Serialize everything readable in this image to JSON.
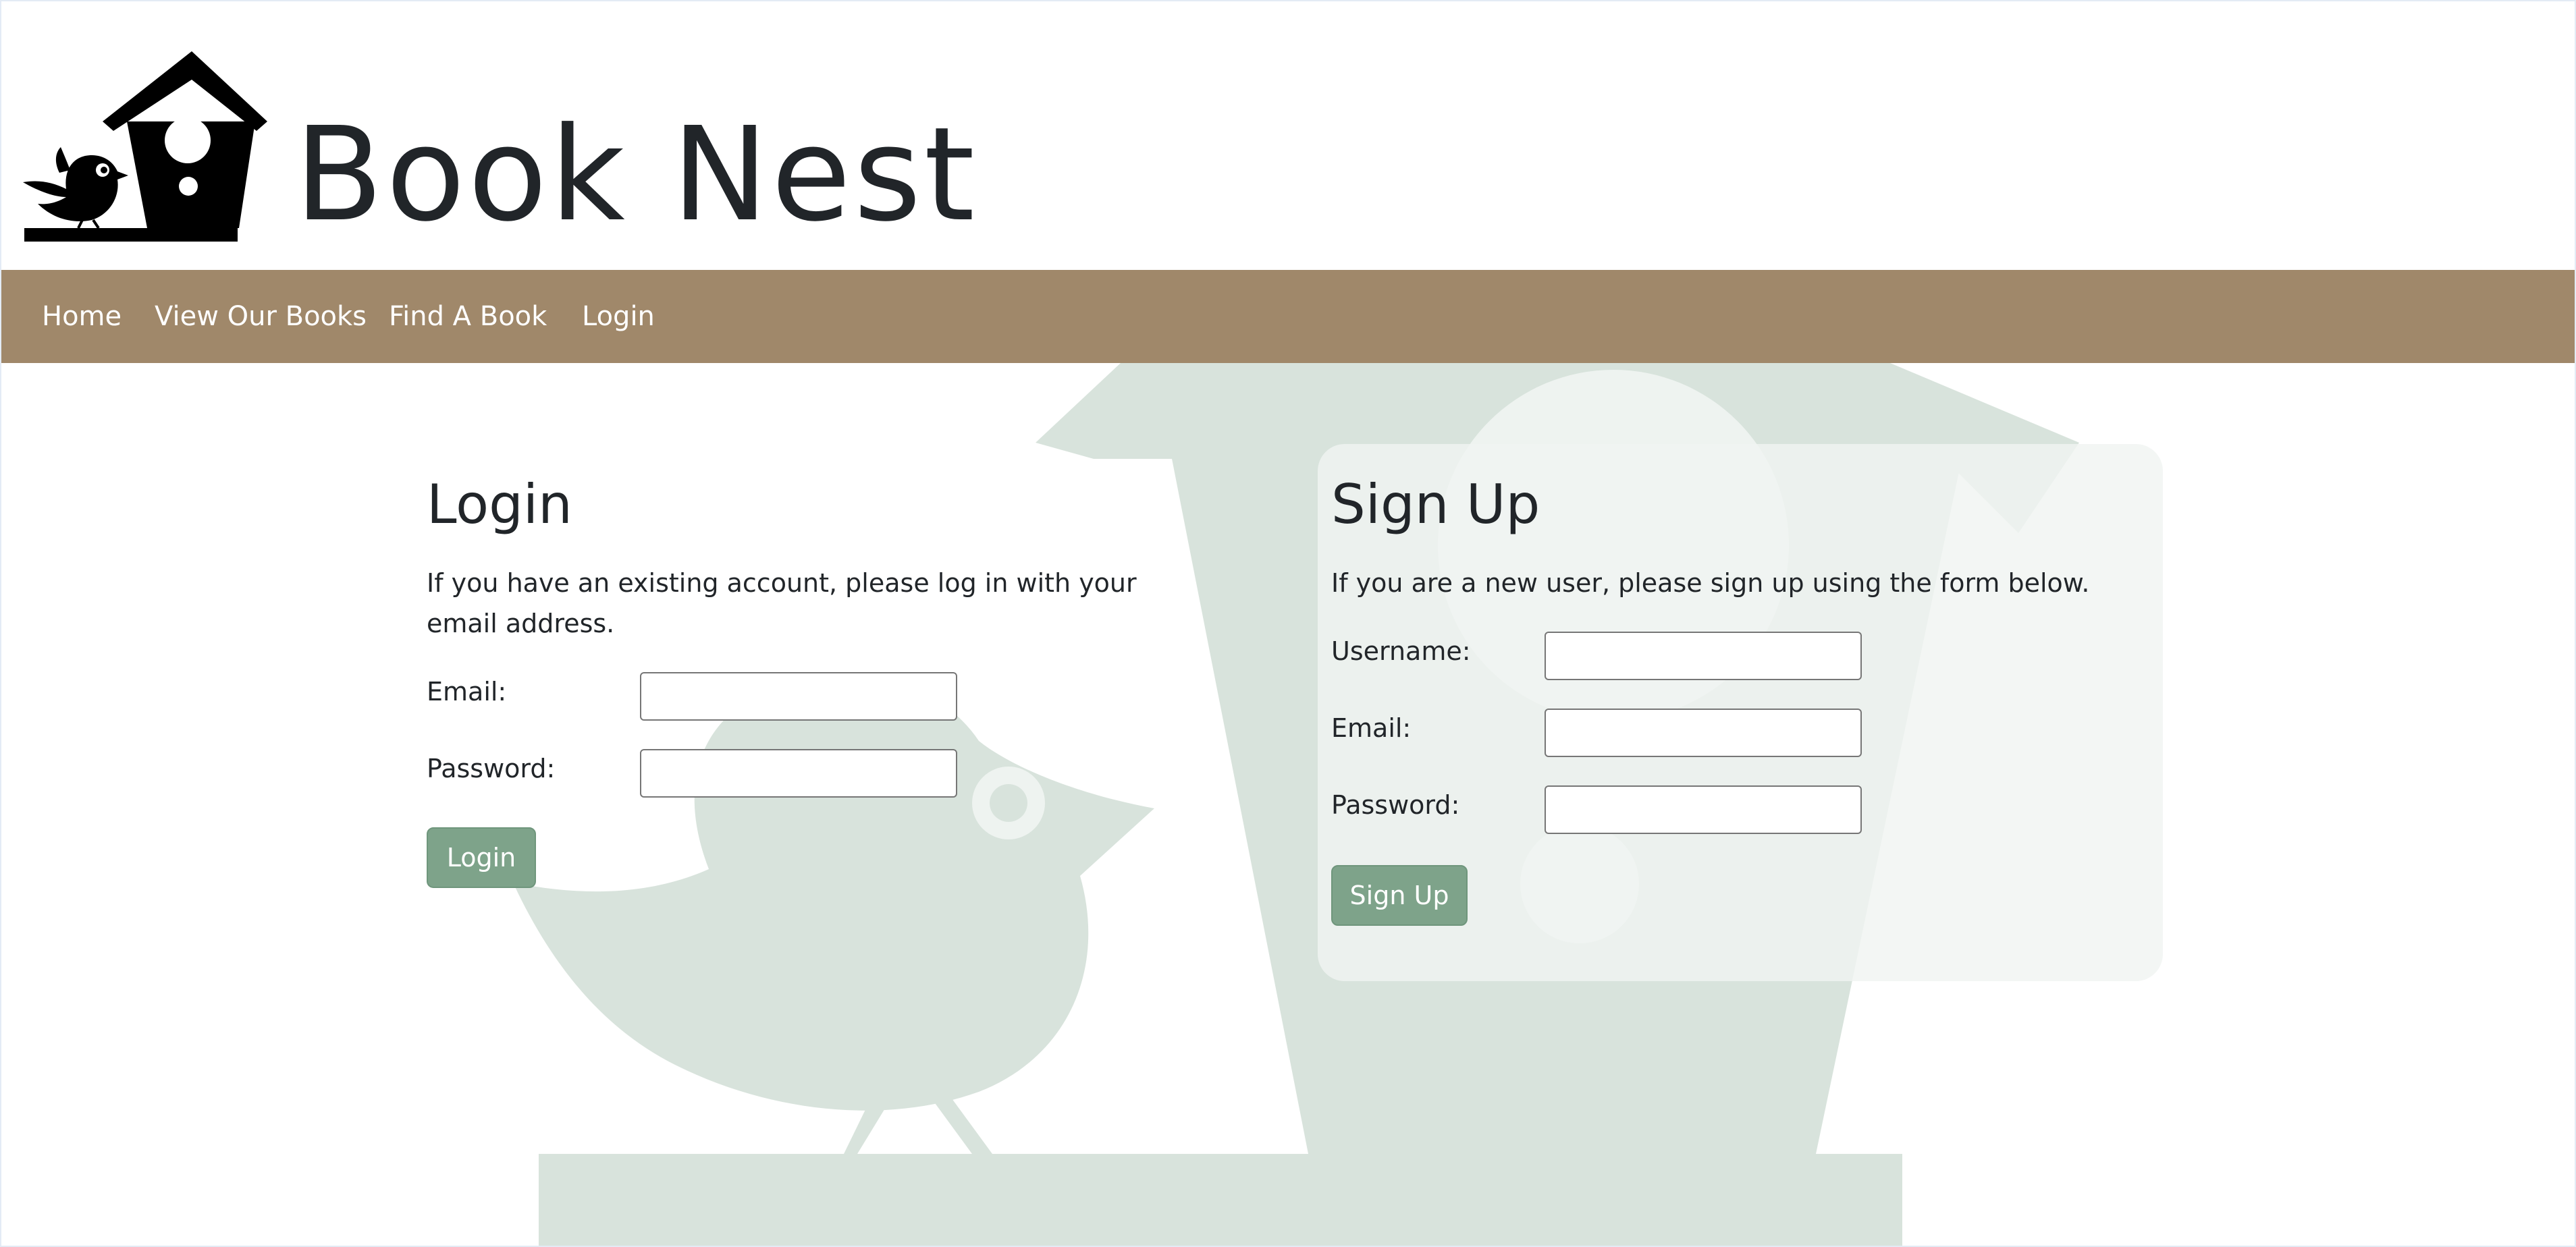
{
  "site": {
    "title": "Book Nest"
  },
  "nav": {
    "items": [
      "Home",
      "View Our Books",
      "Find A Book",
      "Login"
    ]
  },
  "login": {
    "title": "Login",
    "description": "If you have an existing account, please log in with your email address.",
    "email_label": "Email:",
    "email_value": "",
    "password_label": "Password:",
    "password_value": "",
    "button_label": "Login"
  },
  "signup": {
    "title": "Sign Up",
    "description": "If you are a new user, please sign up using the form below.",
    "username_label": "Username:",
    "username_value": "",
    "email_label": "Email:",
    "email_value": "",
    "password_label": "Password:",
    "password_value": "",
    "button_label": "Sign Up"
  },
  "icons": {
    "logo": "birdhouse-bird-logo-icon",
    "watermark": "birdhouse-bird-watermark"
  },
  "colors": {
    "nav_bg": "#a0886a",
    "button_bg": "#7ea38a",
    "watermark": "#d8e3dc",
    "text": "#212529"
  }
}
